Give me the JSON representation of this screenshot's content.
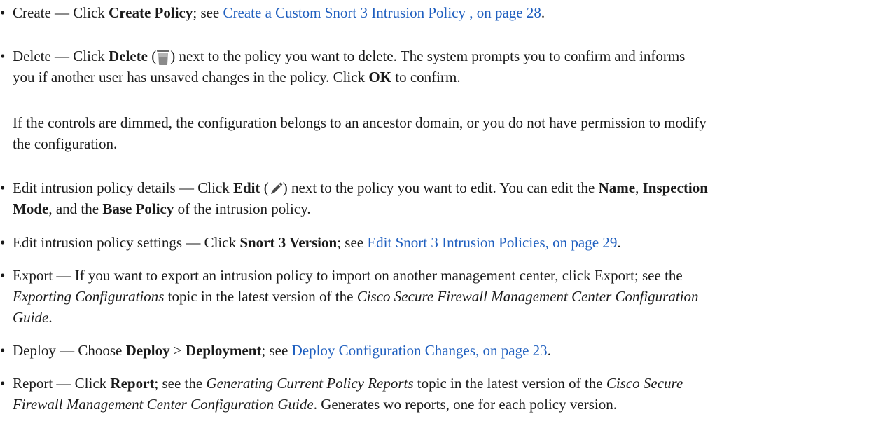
{
  "bullet_char": "•",
  "items": {
    "create": {
      "lead": "Create — Click ",
      "action": "Create Policy",
      "mid": "; see ",
      "link": "Create a Custom Snort 3 Intrusion Policy , on page 28",
      "end": "."
    },
    "delete": {
      "lead": "Delete — Click ",
      "action": "Delete",
      "open_paren": " (",
      "close_paren": ")",
      "icon": "trash-icon",
      "rest_line1": " next to the policy you want to delete. The system prompts you to confirm and informs",
      "line2_a": "you if another user has unsaved changes in the policy. Click ",
      "ok": "OK",
      "line2_b": " to confirm."
    },
    "note": {
      "line1": "If the controls are dimmed, the configuration belongs to an ancestor domain, or you do not have permission to modify",
      "line2": "the configuration."
    },
    "edit_details": {
      "lead": "Edit intrusion policy details — Click ",
      "action": "Edit",
      "open_paren": " (",
      "close_paren": ")",
      "icon": "pencil-icon",
      "rest": " next to the policy you want to edit. You can edit the ",
      "name": "Name",
      "comma": ", ",
      "inspection": "Inspection",
      "mode": "Mode",
      "and_the": ", and the ",
      "base_policy": "Base Policy",
      "end": " of the intrusion policy."
    },
    "edit_settings": {
      "lead": "Edit intrusion policy settings — Click ",
      "action": "Snort 3 Version",
      "mid": "; see ",
      "link": "Edit Snort 3 Intrusion Policies, on page 29",
      "end": "."
    },
    "export": {
      "lead": "Export — If you want to export an intrusion policy to import on another management center, click Export; see the",
      "topic": "Exporting Configurations",
      "mid": " topic in the latest version of the ",
      "guide_a": "Cisco Secure Firewall Management Center Configuration",
      "guide_b": "Guide",
      "end": "."
    },
    "deploy": {
      "lead": "Deploy — Choose ",
      "action1": "Deploy",
      "sep": " > ",
      "action2": "Deployment",
      "mid": "; see ",
      "link": "Deploy Configuration Changes, on page 23",
      "end": "."
    },
    "report": {
      "lead": "Report — Click ",
      "action": "Report",
      "mid": "; see the ",
      "topic": "Generating Current Policy Reports",
      "mid2": " topic in the latest version of the ",
      "guide_a": "Cisco Secure",
      "guide_b": "Firewall Management Center Configuration Guide",
      "end": ". Generates wo reports, one for each policy version."
    }
  }
}
